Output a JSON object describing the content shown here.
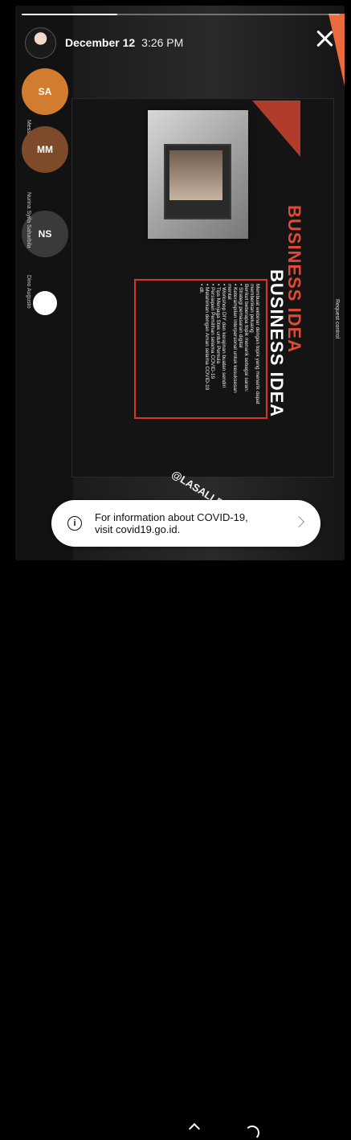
{
  "header": {
    "date": "December 12",
    "time": "3:26 PM"
  },
  "story_progress": 0.3,
  "participants": [
    {
      "initials": "SA",
      "color": "#d27c2f",
      "name": "Messa Marthana"
    },
    {
      "initials": "MM",
      "color": "#7d4b2a",
      "name": ""
    },
    {
      "initials": "NS",
      "color": "#3a3a3a",
      "name": "Nurina Syifa Saharbila"
    },
    {
      "initials": "",
      "color": "#ffffff",
      "name": "Dino Augusto"
    }
  ],
  "slide": {
    "title_red": "BUSINESS IDEA",
    "title_white": "BUSINESS IDEA",
    "lines": [
      "Membuat webinar dengan topik yang menarik dapat",
      "memberikan peluang",
      "Berikut beberapa topik menarik sebagai saran:",
      "• Strategi pemasaran digital",
      "• Keterampilan interpersonal untuk kesuksesan",
      "  mental",
      "• Workshop DIY dan kerajinan buatan sendiri",
      "• Tips Menjaga Stok untuk Pemula",
      "• Persiapan Pemilihan selama COVID-19",
      "• Melahirkan dengan Aman selama COVID-19",
      "• dll."
    ]
  },
  "request_control": "Request control",
  "watermark": "@LASALLEINDONE",
  "notice": {
    "text": "For information about COVID-19, visit covid19.go.id."
  },
  "colors": {
    "accent_red": "#e34932",
    "box_border": "#d9332b"
  }
}
